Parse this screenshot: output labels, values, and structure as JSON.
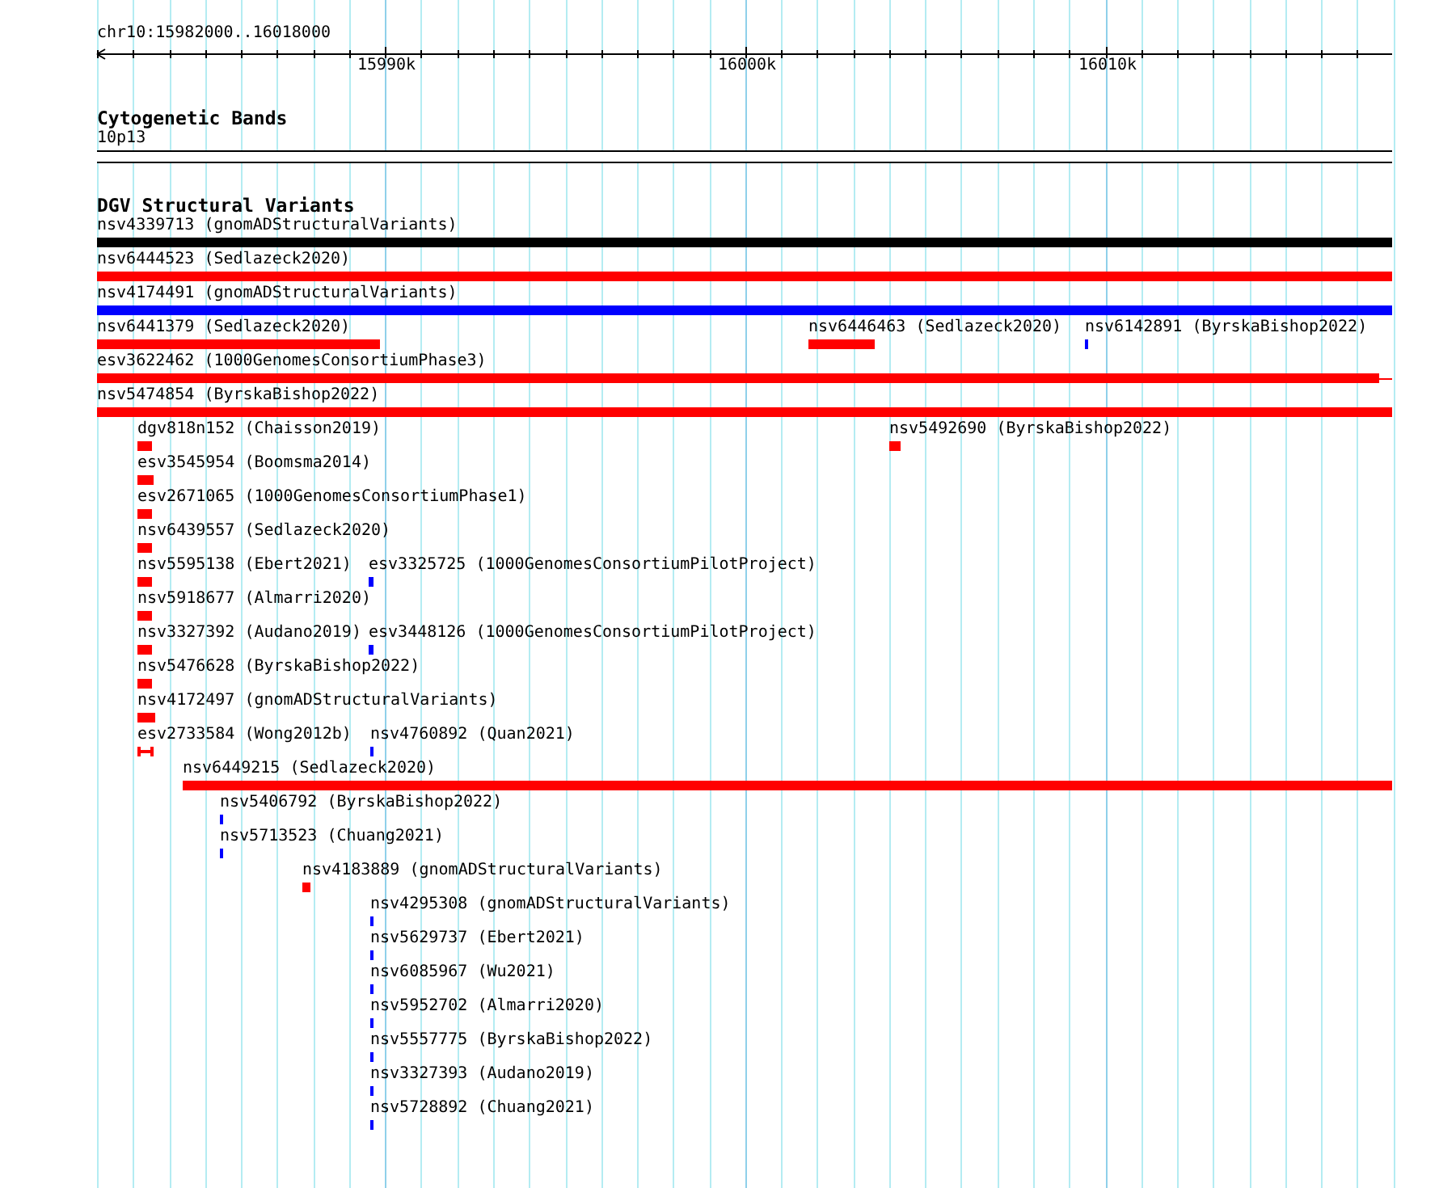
{
  "locus": "chr10:15982000..16018000",
  "ruler": {
    "ticks": [
      "15990k",
      "16000k",
      "16010k"
    ]
  },
  "cytobands": {
    "title": "Cytogenetic Bands",
    "label": "10p13"
  },
  "variants": {
    "title": "DGV Structural Variants",
    "features": [
      {
        "label": "nsv4339713 (gnomADStructuralVariants)",
        "color": "#000000",
        "kind": "bar"
      },
      {
        "label": "nsv6444523 (Sedlazeck2020)",
        "color": "#ff0000",
        "kind": "bar"
      },
      {
        "label": "nsv4174491 (gnomADStructuralVariants)",
        "color": "#0000ff",
        "kind": "bar"
      },
      {
        "label": "nsv6441379 (Sedlazeck2020)",
        "color": "#ff0000",
        "kind": "bar"
      },
      {
        "label": "nsv6446463 (Sedlazeck2020)",
        "color": "#ff0000",
        "kind": "bar"
      },
      {
        "label": "nsv6142891 (ByrskaBishop2022)",
        "color": "#0000ff",
        "kind": "bar"
      },
      {
        "label": "esv3622462 (1000GenomesConsortiumPhase3)",
        "color": "#ff0000",
        "kind": "tailed"
      },
      {
        "label": "nsv5474854 (ByrskaBishop2022)",
        "color": "#ff0000",
        "kind": "bar"
      },
      {
        "label": "dgv818n152 (Chaisson2019)",
        "color": "#ff0000",
        "kind": "bar"
      },
      {
        "label": "nsv5492690 (ByrskaBishop2022)",
        "color": "#ff0000",
        "kind": "bar"
      },
      {
        "label": "esv3545954 (Boomsma2014)",
        "color": "#ff0000",
        "kind": "bar"
      },
      {
        "label": "esv2671065 (1000GenomesConsortiumPhase1)",
        "color": "#ff0000",
        "kind": "bar"
      },
      {
        "label": "nsv6439557 (Sedlazeck2020)",
        "color": "#ff0000",
        "kind": "bar"
      },
      {
        "label": "nsv5595138 (Ebert2021)",
        "color": "#ff0000",
        "kind": "bar"
      },
      {
        "label": "esv3325725 (1000GenomesConsortiumPilotProject)",
        "color": "#0000ff",
        "kind": "bar"
      },
      {
        "label": "nsv5918677 (Almarri2020)",
        "color": "#ff0000",
        "kind": "bar"
      },
      {
        "label": "nsv3327392 (Audano2019)",
        "color": "#ff0000",
        "kind": "bar"
      },
      {
        "label": "esv3448126 (1000GenomesConsortiumPilotProject)",
        "color": "#0000ff",
        "kind": "bar"
      },
      {
        "label": "nsv5476628 (ByrskaBishop2022)",
        "color": "#ff0000",
        "kind": "bar"
      },
      {
        "label": "nsv4172497 (gnomADStructuralVariants)",
        "color": "#ff0000",
        "kind": "bar"
      },
      {
        "label": "esv2733584 (Wong2012b)",
        "color": "#ff0000",
        "kind": "span"
      },
      {
        "label": "nsv4760892 (Quan2021)",
        "color": "#0000ff",
        "kind": "bar"
      },
      {
        "label": "nsv6449215 (Sedlazeck2020)",
        "color": "#ff0000",
        "kind": "bar"
      },
      {
        "label": "nsv5406792 (ByrskaBishop2022)",
        "color": "#0000ff",
        "kind": "bar"
      },
      {
        "label": "nsv5713523 (Chuang2021)",
        "color": "#0000ff",
        "kind": "bar"
      },
      {
        "label": "nsv4183889 (gnomADStructuralVariants)",
        "color": "#ff0000",
        "kind": "bar"
      },
      {
        "label": "nsv4295308 (gnomADStructuralVariants)",
        "color": "#0000ff",
        "kind": "bar"
      },
      {
        "label": "nsv5629737 (Ebert2021)",
        "color": "#0000ff",
        "kind": "bar"
      },
      {
        "label": "nsv6085967 (Wu2021)",
        "color": "#0000ff",
        "kind": "bar"
      },
      {
        "label": "nsv5952702 (Almarri2020)",
        "color": "#0000ff",
        "kind": "bar"
      },
      {
        "label": "nsv5557775 (ByrskaBishop2022)",
        "color": "#0000ff",
        "kind": "bar"
      },
      {
        "label": "nsv3327393 (Audano2019)",
        "color": "#0000ff",
        "kind": "bar"
      },
      {
        "label": "nsv5728892 (Chuang2021)",
        "color": "#0000ff",
        "kind": "bar"
      }
    ]
  }
}
